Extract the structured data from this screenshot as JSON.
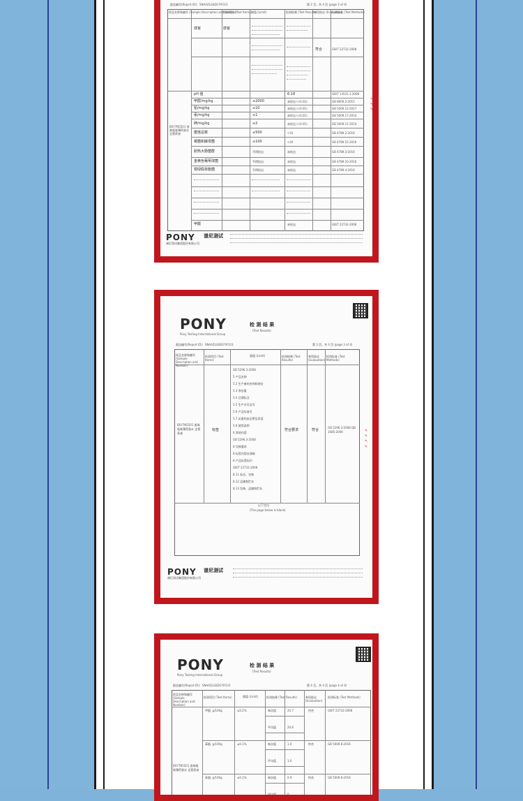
{
  "brand": {
    "logo_text": "PONY",
    "logo_cn": "谱尼测试",
    "sub": "Pony Testing International Group"
  },
  "page1": {
    "report_no": "报告编号(Report ID)：SNAAZLG82G?9?2/3",
    "page_no": "第 2 页，共 4 页 (page 2 of 4)",
    "headers": [
      "样品名称和编号 (Sample Description and Number)",
      "检测项目 (Test Items)",
      "限值 (Limit)",
      "检测结果 (Test Results)",
      "单项结论 (Evaluation)",
      "检测标准 (Test Methods)"
    ],
    "sample": "BSY7N5501 香珠瓶装薄荷香水 全营养液",
    "items": [
      [
        "感官",
        "容器外观",
        "符合",
        "GB/T 22732-2008"
      ],
      [
        "",
        "色泽",
        "符合",
        ""
      ],
      [
        "",
        "香气",
        "符合",
        ""
      ],
      [
        "pH 值",
        "",
        "6.18",
        "GB/T 13531.1-2008"
      ],
      [
        "甲醇/mg/kg",
        "≤2000",
        "未检出 (<0.02)",
        "GB 8009.2-2015"
      ],
      [
        "铅/mg/kg",
        "≤10",
        "未检出 (<0.01)",
        "GB 5009.12-2017"
      ],
      [
        "汞/mg/kg",
        "≤1",
        "未检出 (<0.01)",
        "GB 5009.17-2014"
      ],
      [
        "砷/mg/kg",
        "≤2",
        "未检出 (<0.01)",
        "GB 5009.11-2014"
      ],
      [
        "菌落总数",
        "≤500",
        "<10",
        "GB 4789.2-2016"
      ],
      [
        "霉菌和酵母菌",
        "≤100",
        "<10",
        "GB 4789.15-2016"
      ],
      [
        "耐热大肠菌群",
        "不得检出",
        "未检出",
        "GB 4789.3-2016"
      ],
      [
        "金黄色葡萄球菌",
        "不得检出",
        "未检出",
        "GB 4789.10-2016"
      ],
      [
        "铜绿假单胞菌",
        "不得检出",
        "未检出",
        "GB 4789.4-2016"
      ],
      [
        "甲醛",
        "",
        "未检出",
        "GB/T 22732-2008"
      ]
    ],
    "footer_addr": "谱尼测试集团股份有限公司"
  },
  "page2": {
    "title_cn": "检 测 结 果",
    "title_en": "(Test Results)",
    "report_no": "报告编号(Report ID)：SNAAZLG82G?9?2/3",
    "page_no": "第 3 页，共 4 页 (page 3 of 4)",
    "headers": [
      "样品名称和编号 (Sample Description and Number)",
      "检测项目 (Test Items)",
      "限值 (Limit)",
      "检测结果 (Test Results)",
      "单项结论 (Evaluation)",
      "检测标准 (Test Methods)"
    ],
    "sample": "BSY7N5501 香珠瓶装薄荷香水 全营养液",
    "item": "标签",
    "limits": [
      "GB 5296.3-2008",
      "5 产品名称",
      "5.2 生产者的名称和地址",
      "5.3 净含量",
      "5.4 日期标注",
      "5.5 生产许可证号",
      "5.6 产品标准号",
      "5.7 必要的安全警告用语",
      "5.8 使用说明",
      "6 其他内容",
      "GB 5296.3-2008",
      "8 包装要求",
      "8 标签内容应清晰",
      "8 产品标签标识",
      "GB/T 22732-2008",
      "8.11 标志、包装",
      "8.12 运输和贮存",
      "8.13 包装、运输和贮存"
    ],
    "result": "符合要求",
    "evaluation": "符合",
    "methods": "GB 5296.3-2008 QB 1685-2006",
    "blank_note": "以下空白",
    "blank_note_en": "(The page below is blank)",
    "footer_addr": "谱尼测试集团股份有限公司"
  },
  "page3": {
    "title_cn": "检 测 结 果",
    "title_en": "(Test Results)",
    "report_no": "报告编号(Report ID)：SNAAZLG82G?9?2/3",
    "page_no": "第 4 页，共 4 页 (page 4 of 4)",
    "headers": [
      "样品名称和编号 (Sample Description and Number)",
      "检测项目 (Test Items)",
      "限值 (Limit)",
      "检测结果 (Test Results)",
      "单项结论 (Evaluation)",
      "检测标准 (Test Methods)"
    ],
    "rows": [
      [
        "甲醛, g/100g",
        "≤0.2%",
        "每次值",
        "20.7",
        "符合",
        "GB/T 22732-2008"
      ],
      [
        "",
        "",
        "平均值",
        "20.6",
        "",
        ""
      ],
      [
        "苯酚, g/100g",
        "≤0.1%",
        "每次值",
        "1.0",
        "符合",
        "GB 5009.8-2016"
      ],
      [
        "",
        "",
        "平均值",
        "1.0",
        "",
        ""
      ],
      [
        "苯胺, g/100g",
        "≤0.1%",
        "每次值",
        "0.9",
        "符合",
        "GB 5009.8-2016"
      ],
      [
        "",
        "",
        "平均值",
        "0",
        "",
        ""
      ]
    ],
    "sample": "BSY7N5501 香珠瓶装薄荷香水 全营养液"
  }
}
